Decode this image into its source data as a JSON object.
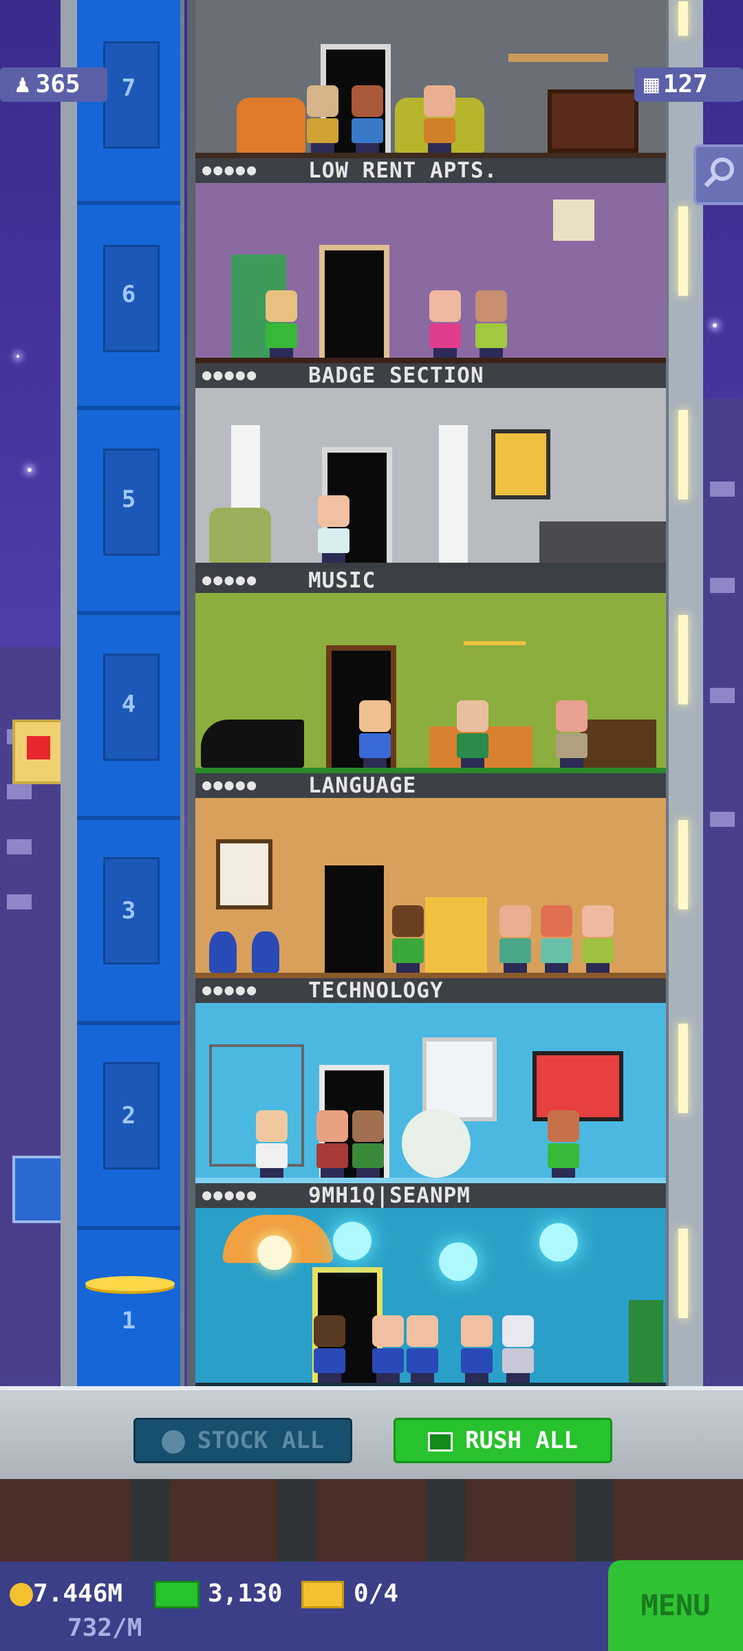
{
  "hud": {
    "population": "365",
    "floors_count": "127"
  },
  "elevator": {
    "floor_numbers": [
      "7",
      "6",
      "5",
      "4",
      "3",
      "2",
      "1"
    ]
  },
  "floors": [
    {
      "name": "LOW RENT APTS.",
      "stars": "●●●●●"
    },
    {
      "name": "BADGE SECTION",
      "stars": "●●●●●"
    },
    {
      "name": "MUSIC",
      "stars": "●●●●●"
    },
    {
      "name": "LANGUAGE",
      "stars": "●●●●●"
    },
    {
      "name": "TECHNOLOGY",
      "stars": "●●●●●"
    },
    {
      "name": "9MH1Q|SEANPM",
      "stars": "●●●●●"
    }
  ],
  "controls": {
    "stock_all": "STOCK ALL",
    "rush_all": "RUSH ALL"
  },
  "status": {
    "coins": "7.446M",
    "coins_rate": "732/M",
    "bux": "3,130",
    "tickets": "0/4",
    "menu": "MENU"
  },
  "colors": {
    "rush_green": "#29c22f",
    "stock_blue": "#174f6e",
    "elevator_blue": "#1666d8",
    "night_sky": "#3a2a8a"
  }
}
